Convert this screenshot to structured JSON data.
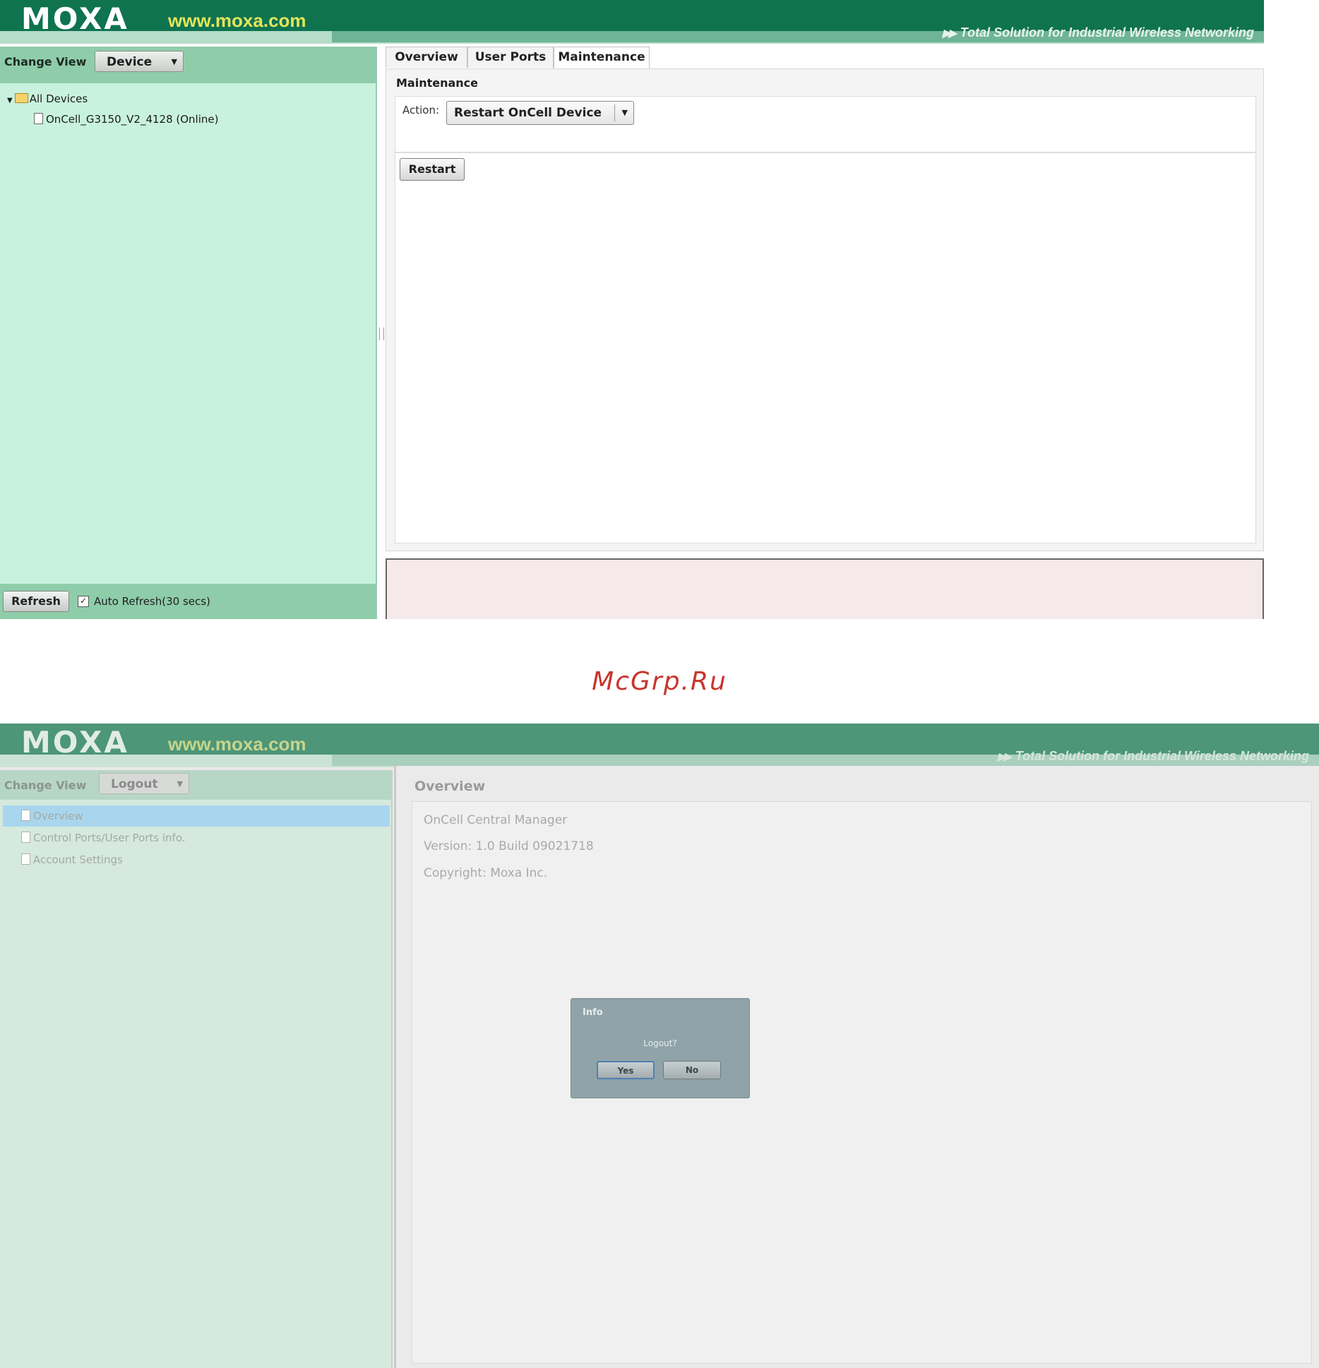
{
  "brand": {
    "logo": "MOXA",
    "url": "www.moxa.com",
    "tagline": "Total Solution for Industrial Wireless Networking"
  },
  "screen1": {
    "change_view_label": "Change View",
    "change_view_value": "Device",
    "tree": {
      "root_label": "All Devices",
      "device_label": "OnCell_G3150_V2_4128 (Online)"
    },
    "tabs": [
      "Overview",
      "User Ports",
      "Maintenance"
    ],
    "active_tab": "Maintenance",
    "section_title": "Maintenance",
    "action_label": "Action:",
    "action_value": "Restart OnCell Device",
    "restart_button": "Restart",
    "refresh_button": "Refresh",
    "auto_refresh_label": "Auto Refresh(30 secs)",
    "auto_refresh_checked": true
  },
  "watermark": "McGrp.Ru",
  "screen2": {
    "change_view_label": "Change View",
    "change_view_value": "Logout",
    "nav_items": [
      "Overview",
      "Control Ports/User Ports info.",
      "Account Settings"
    ],
    "selected_nav": "Overview",
    "panel_title": "Overview",
    "info": {
      "product": "OnCell Central Manager",
      "version": "Version: 1.0 Build 09021718",
      "copyright": "Copyright: Moxa Inc."
    },
    "dialog": {
      "title": "Info",
      "message": "Logout?",
      "yes": "Yes",
      "no": "No"
    }
  },
  "colors": {
    "header_dark": "#0f7350",
    "header_light": "#b5ddc8",
    "left_panel": "#c8f2dd",
    "panel_bar": "#8fcdaa",
    "url_yellow": "#e3e55a",
    "watermark_red": "#c8352c"
  }
}
